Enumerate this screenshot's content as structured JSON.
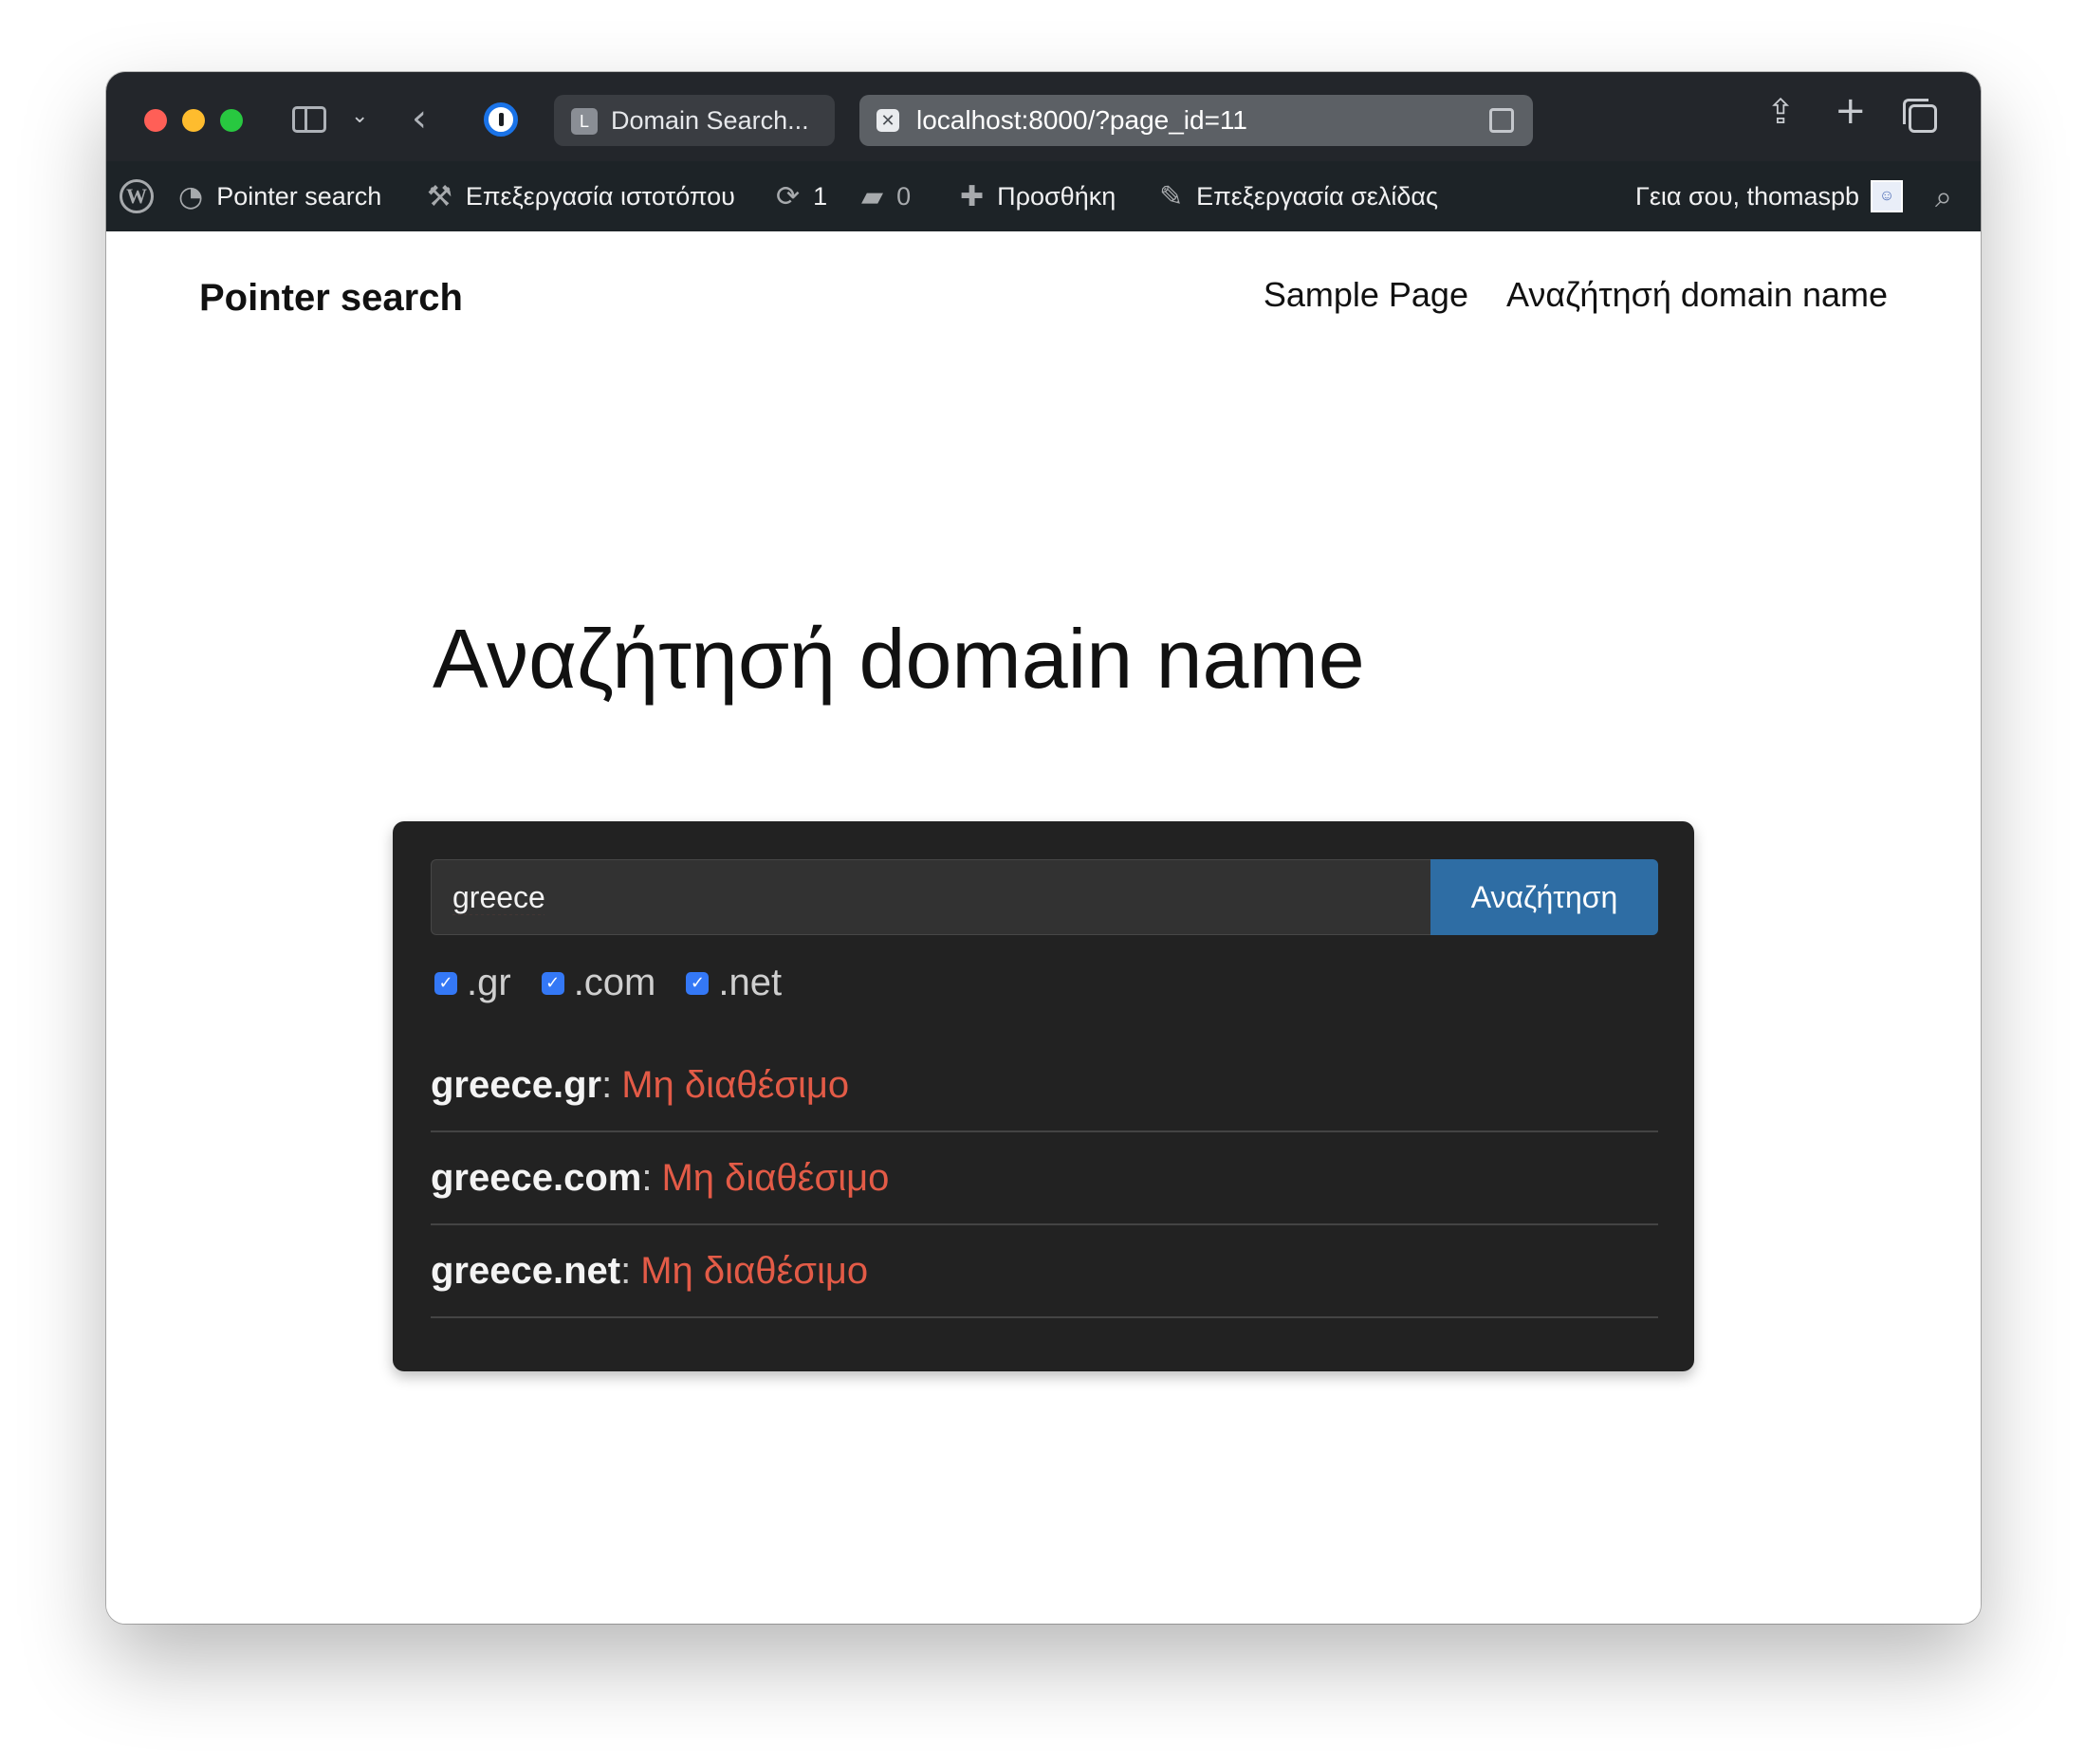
{
  "browser": {
    "tab_inactive_favicon": "L",
    "tab_inactive_title": "Domain Search...",
    "url": "localhost:8000/?page_id=11"
  },
  "admin_bar": {
    "site_name": "Pointer search",
    "edit_site": "Επεξεργασία ιστοτόπου",
    "updates_count": "1",
    "comments_count": "0",
    "new_label": "Προσθήκη",
    "edit_page": "Επεξεργασία σελίδας",
    "greeting": "Γεια σου, thomaspb"
  },
  "site": {
    "title": "Pointer search",
    "nav": [
      "Sample Page",
      "Αναζήτησή domain name"
    ]
  },
  "page": {
    "heading": "Αναζήτησή domain name"
  },
  "search": {
    "value": "greece",
    "button_label": "Αναζήτηση",
    "tlds": [
      {
        "label": ".gr",
        "checked": true
      },
      {
        "label": ".com",
        "checked": true
      },
      {
        "label": ".net",
        "checked": true
      }
    ]
  },
  "results": [
    {
      "domain": "greece.gr",
      "separator": ":",
      "status": "Μη διαθέσιμο"
    },
    {
      "domain": "greece.com",
      "separator": ":",
      "status": "Μη διαθέσιμο"
    },
    {
      "domain": "greece.net",
      "separator": ":",
      "status": "Μη διαθέσιμο"
    }
  ],
  "colors": {
    "button": "#2e6da4",
    "unavailable": "#e35b47",
    "card_bg": "#222222",
    "admin_bar": "#1d2327"
  }
}
